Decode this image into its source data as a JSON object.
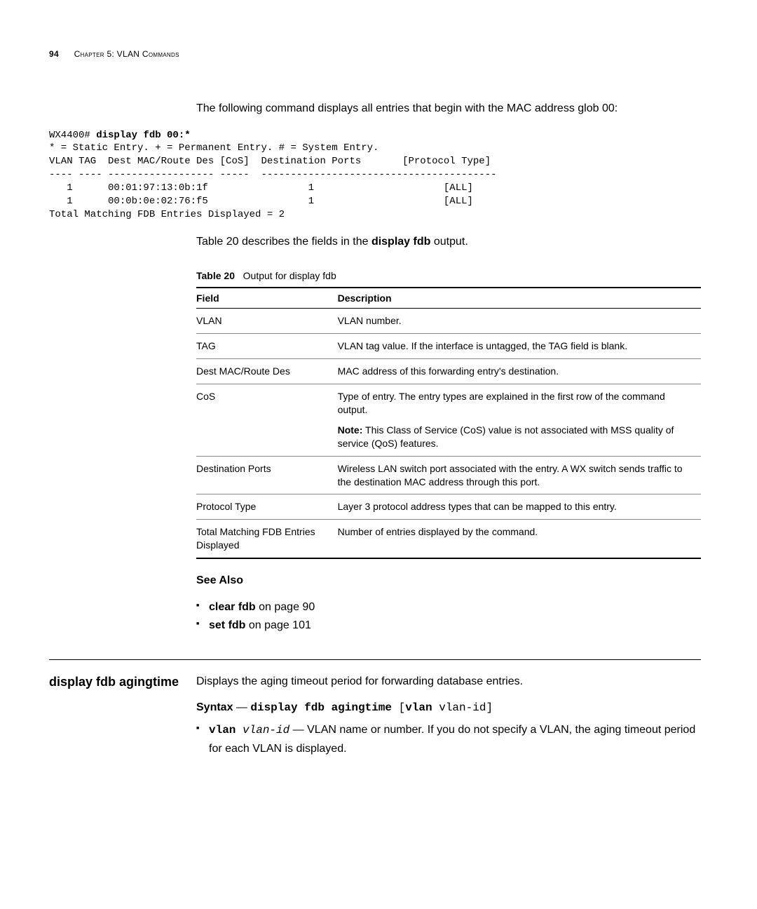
{
  "header": {
    "page_number": "94",
    "chapter_label": "Chapter 5: VLAN Commands"
  },
  "intro_para": "The following command displays all entries that begin with the MAC address glob 00:",
  "terminal": {
    "prompt": "WX4400# ",
    "command": "display fdb 00:*",
    "legend": "* = Static Entry. + = Permanent Entry. # = System Entry.",
    "header_row": "VLAN TAG  Dest MAC/Route Des [CoS]  Destination Ports       [Protocol Type]",
    "rule_row": "---- ---- ------------------ -----  ----------------------------------------",
    "rows": [
      "   1      00:01:97:13:0b:1f                 1                      [ALL]",
      "   1      00:0b:0e:02:76:f5                 1                      [ALL]"
    ],
    "footer": "Total Matching FDB Entries Displayed = 2"
  },
  "table_intro": "Table 20 describes the fields in the display fdb output.",
  "table_intro_bold": "display fdb",
  "table_caption_label": "Table 20",
  "table_caption_text": "Output for display fdb",
  "table_headers": {
    "field": "Field",
    "desc": "Description"
  },
  "table_rows": [
    {
      "field": "VLAN",
      "desc": "VLAN number."
    },
    {
      "field": "TAG",
      "desc": "VLAN tag value. If the interface is untagged, the TAG field is blank."
    },
    {
      "field": "Dest MAC/Route Des",
      "desc": "MAC address of this forwarding entry's destination."
    },
    {
      "field": "CoS",
      "desc": "Type of entry. The entry types are explained in the first row of the command output.",
      "no_border": true
    },
    {
      "field": "",
      "desc_prefix_bold": "Note:",
      "desc": " This Class of Service (CoS) value is not associated with MSS quality of service (QoS) features."
    },
    {
      "field": "Destination Ports",
      "desc": "Wireless LAN switch port associated with the entry. A WX switch sends traffic to the destination MAC address through this port."
    },
    {
      "field": "Protocol Type",
      "desc": "Layer 3 protocol address types that can be mapped to this entry."
    },
    {
      "field": "Total Matching FDB Entries Displayed",
      "desc": "Number of entries displayed by the command."
    }
  ],
  "see_also_label": "See Also",
  "see_also_items": [
    {
      "bold": "clear fdb",
      "rest": " on page 90"
    },
    {
      "bold": "set fdb",
      "rest": " on page 101"
    }
  ],
  "section2": {
    "heading": "display fdb agingtime",
    "intro": "Displays the aging timeout period for forwarding database entries.",
    "syntax_label": "Syntax",
    "syntax_dash": " — ",
    "syntax_cmd_bold": "display fdb agingtime ",
    "syntax_cmd_rest": "[",
    "syntax_cmd_bold2": "vlan ",
    "syntax_cmd_italic": "vlan-id",
    "syntax_cmd_rest2": "]",
    "bullet_code_bold": "vlan ",
    "bullet_code_italic": "vlan-id",
    "bullet_text": " — VLAN name or number. If you do not specify a VLAN, the aging timeout period for each VLAN is displayed."
  }
}
